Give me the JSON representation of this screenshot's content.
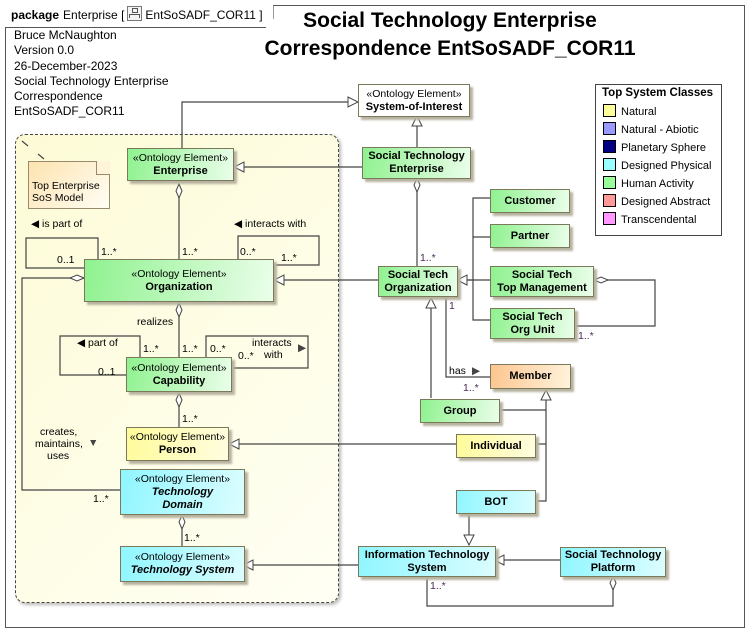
{
  "package": {
    "keyword": "package",
    "name": "Enterprise",
    "diagram_name": "EntSoSADF_COR11",
    "icon": "class-diagram-icon"
  },
  "title": {
    "line1": "Social Technology Enterprise",
    "line2": "Correspondence EntSoSADF_COR11"
  },
  "meta": {
    "author": "Bruce McNaughton",
    "version": "Version 0.0",
    "date": "26-December-2023",
    "line4": "Social Technology Enterprise",
    "line5": "Correspondence",
    "line6": "EntSoSADF_COR11"
  },
  "legend": {
    "title": "Top System Classes",
    "items": [
      {
        "label": "Natural",
        "color": "#ffff99"
      },
      {
        "label": "Natural - Abiotic",
        "color": "#9999ff"
      },
      {
        "label": "Planetary Sphere",
        "color": "#000080"
      },
      {
        "label": "Designed Physical",
        "color": "#99ffff"
      },
      {
        "label": "Human Activity",
        "color": "#99ff99"
      },
      {
        "label": "Designed Abstract",
        "color": "#ff9999"
      },
      {
        "label": "Transcendental",
        "color": "#ff99ff"
      }
    ]
  },
  "note": {
    "text_line1": "Top Enterprise",
    "text_line2": "SoS Model"
  },
  "stereotype": "«Ontology Element»",
  "classes": {
    "system_of_interest": "System-of-Interest",
    "enterprise": "Enterprise",
    "organization": "Organization",
    "capability": "Capability",
    "person": "Person",
    "technology_domain_l1": "Technology",
    "technology_domain_l2": "Domain",
    "technology_system": "Technology System",
    "ste_l1": "Social Technology",
    "ste_l2": "Enterprise",
    "sto_l1": "Social Tech",
    "sto_l2": "Organization",
    "customer": "Customer",
    "partner": "Partner",
    "sttm_l1": "Social Tech",
    "sttm_l2": "Top Management",
    "stou_l1": "Social Tech",
    "stou_l2": "Org Unit",
    "member": "Member",
    "group": "Group",
    "individual": "Individual",
    "bot": "BOT",
    "its_l1": "Information Technology",
    "its_l2": "System",
    "stp_l1": "Social Technology",
    "stp_l2": "Platform"
  },
  "labels": {
    "is_part_of": "◀ is part of",
    "interacts_with_org": "◀ interacts with",
    "realizes": "realizes",
    "part_of": "◀ part of",
    "interacts_cap_l1": "interacts",
    "interacts_cap_l2": "with",
    "interacts_cap_arrow": "▶",
    "creates_l1": "creates,",
    "creates_l2": "maintains,",
    "creates_l3": "uses",
    "creates_arrow": "▼",
    "has": "has",
    "has_arrow": "▶"
  },
  "multiplicities": {
    "org_self_a": "0..1",
    "org_self_b": "1..*",
    "ent_org": "1..*",
    "org_inter_a": "0..*",
    "org_inter_b": "1..*",
    "cap_self_a": "1..*",
    "cap_self_b": "0..1",
    "org_cap": "1..*",
    "cap_inter_a": "0..*",
    "cap_inter_b": "0..*",
    "cap_person": "1..*",
    "org_techdomain": "1..*",
    "td_ts": "1..*",
    "ste_sto": "1..*",
    "sto_member_a": "1",
    "sto_member_b": "1..*",
    "sttm_stou": "1..*",
    "its_stp": "1..*"
  }
}
